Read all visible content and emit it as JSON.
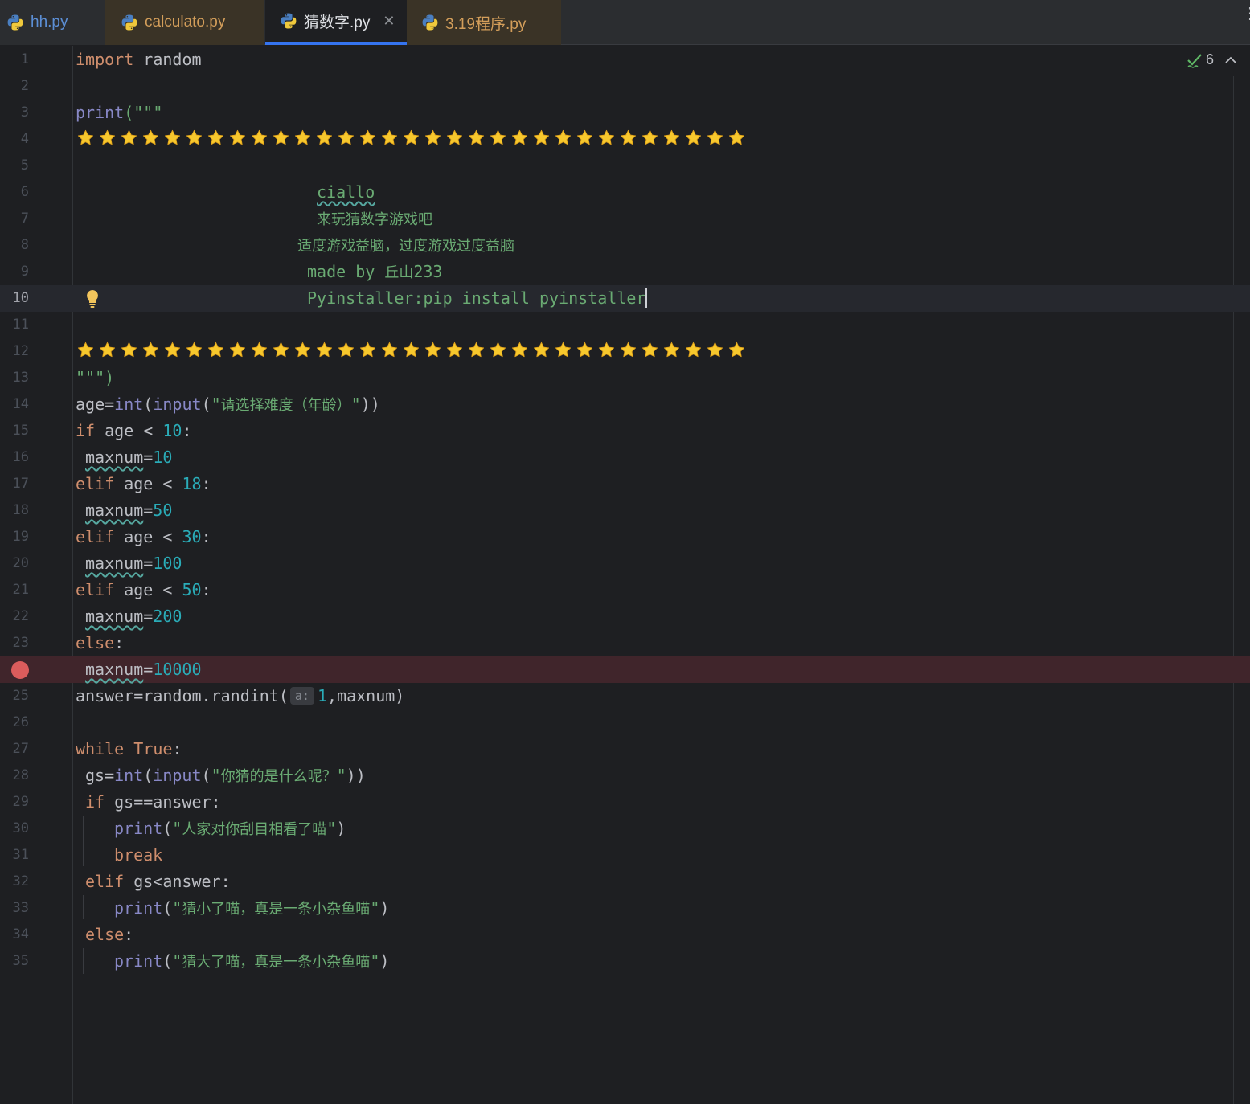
{
  "tabs": [
    {
      "label": "hh.py"
    },
    {
      "label": "calculato.py"
    },
    {
      "label": "猜数字.py",
      "active": true
    },
    {
      "label": "3.19程序.py"
    }
  ],
  "inspection": {
    "count": "6"
  },
  "inlay_hint": "a:",
  "line_numbers": [
    "1",
    "2",
    "3",
    "4",
    "5",
    "6",
    "7",
    "8",
    "9",
    "10",
    "11",
    "12",
    "13",
    "14",
    "15",
    "16",
    "17",
    "18",
    "19",
    "20",
    "21",
    "22",
    "23",
    "",
    "25",
    "26",
    "27",
    "28",
    "29",
    "30",
    "31",
    "32",
    "33",
    "34",
    "35"
  ],
  "code": {
    "l1_kw": "import",
    "l1_rest": " random",
    "l3_fn": "print",
    "l3_rest": "(\"\"\"",
    "l6": "ciallo",
    "l7": "来玩猜数字游戏吧",
    "l8": "适度游戏益脑，过度游戏过度益脑",
    "l9_a": "made by ",
    "l9_b": "丘山",
    "l9_c": "233",
    "l10": "Pyinstaller:pip install pyinstaller",
    "l13": "\"\"\")",
    "l14_a": "age=",
    "l14_int": "int",
    "l14_b": "(",
    "l14_input": "input",
    "l14_c": "(",
    "l14_q1": "\"",
    "l14_str": "请选择难度（年龄）",
    "l14_q2": "\"",
    "l14_d": "))",
    "l15_kw": "if",
    "l15_a": " age < ",
    "l15_num": "10",
    "l15_b": ":",
    "l16_var": "maxnum",
    "l16_eq": "=",
    "l16_num": "10",
    "l17_kw": "elif",
    "l17_a": " age < ",
    "l17_num": "18",
    "l17_b": ":",
    "l18_var": "maxnum",
    "l18_eq": "=",
    "l18_num": "50",
    "l19_kw": "elif",
    "l19_a": " age < ",
    "l19_num": "30",
    "l19_b": ":",
    "l20_var": "maxnum",
    "l20_eq": "=",
    "l20_num": "100",
    "l21_kw": "elif",
    "l21_a": " age < ",
    "l21_num": "50",
    "l21_b": ":",
    "l22_var": "maxnum",
    "l22_eq": "=",
    "l22_num": "200",
    "l23_kw": "else",
    "l23_b": ":",
    "l24_var": "maxnum",
    "l24_eq": "=",
    "l24_num": "10000",
    "l25_a": "answer=random.randint(",
    "l25_num": "1",
    "l25_b": ",maxnum)",
    "l27_kw1": "while",
    "l27_kw2": "True",
    "l27_b": ":",
    "l28_a": "gs=",
    "l28_int": "int",
    "l28_b": "(",
    "l28_input": "input",
    "l28_c": "(",
    "l28_q1": "\"",
    "l28_str": "你猜的是什么呢？",
    "l28_q2": "\"",
    "l28_d": "))",
    "l29_kw": "if",
    "l29_a": " gs==answer:",
    "l30_fn": "print",
    "l30_a": "(",
    "l30_q1": "\"",
    "l30_str": "人家对你刮目相看了喵",
    "l30_q2": "\"",
    "l30_b": ")",
    "l31_kw": "break",
    "l32_kw": "elif",
    "l32_a": " gs<answer:",
    "l33_fn": "print",
    "l33_a": "(",
    "l33_q1": "\"",
    "l33_str": "猜小了喵，真是一条小杂鱼喵",
    "l33_q2": "\"",
    "l33_b": ")",
    "l34_kw": "else",
    "l34_b": ":",
    "l35_fn": "print",
    "l35_a": "(",
    "l35_q1": "\"",
    "l35_str": "猜大了喵，真是一条小杂鱼喵",
    "l35_q2": "\"",
    "l35_b": ")"
  },
  "colors": {
    "background": "#1e1f22",
    "keyword": "#cf8e6d",
    "builtin": "#8888c6",
    "string": "#6aab73",
    "number": "#2aacb8",
    "accent": "#3574f0",
    "breakpoint": "#db5c5c",
    "star": "#f7c82d"
  },
  "icons": {
    "tab": "python-icon",
    "line4": "star-emoji",
    "line10": "lightbulb-icon",
    "line24": "breakpoint-icon",
    "inspection": "check-icon"
  }
}
